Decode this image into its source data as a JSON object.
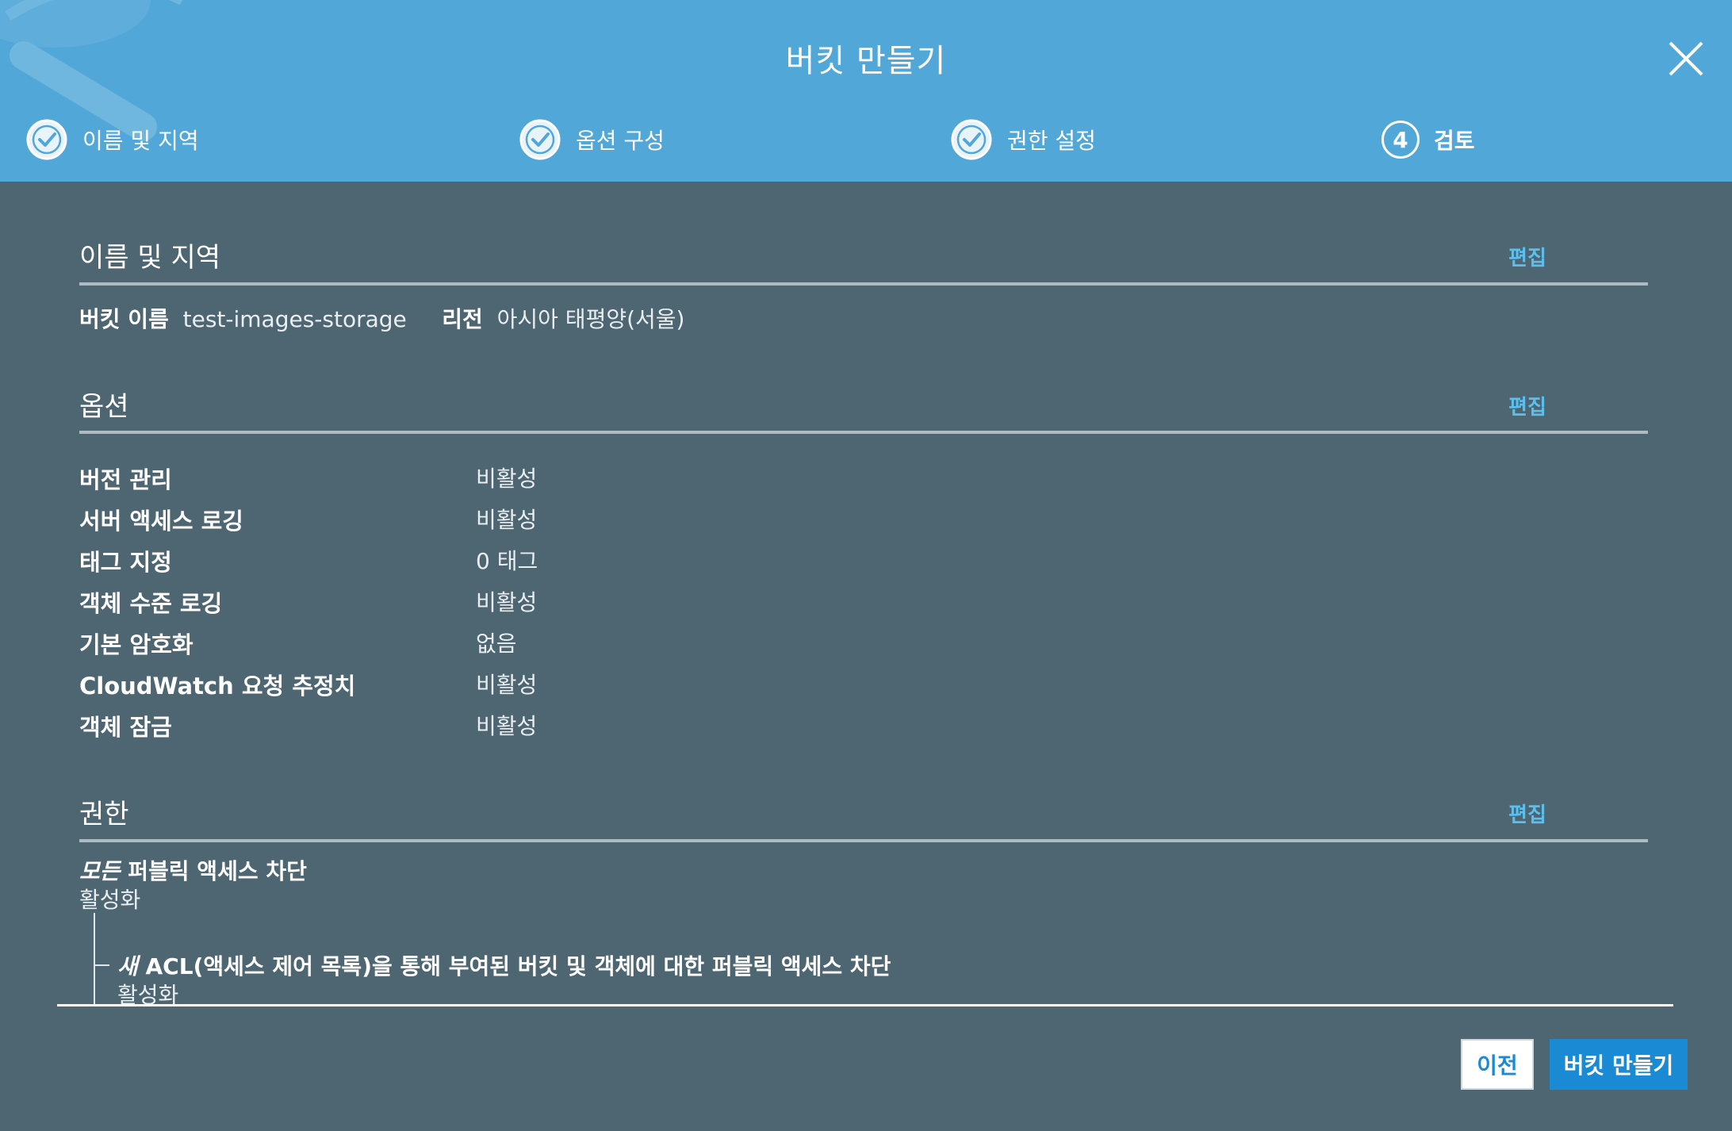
{
  "dialog": {
    "title": "버킷 만들기",
    "close_icon": "close-icon"
  },
  "steps": [
    {
      "label": "이름 및 지역",
      "icon": "check-circle-icon",
      "state": "done"
    },
    {
      "label": "옵션 구성",
      "icon": "check-circle-icon",
      "state": "done"
    },
    {
      "label": "권한 설정",
      "icon": "check-circle-icon",
      "state": "done"
    },
    {
      "label": "검토",
      "number": "4",
      "state": "current"
    }
  ],
  "name_region": {
    "title": "이름 및 지역",
    "edit": "편집",
    "bucket_name_label": "버킷 이름",
    "bucket_name": "test-images-storage",
    "region_label": "리전",
    "region": "아시아 태평양(서울)"
  },
  "options": {
    "title": "옵션",
    "edit": "편집",
    "rows": [
      {
        "label": "버전 관리",
        "value": "비활성"
      },
      {
        "label": "서버 액세스 로깅",
        "value": "비활성"
      },
      {
        "label": "태그 지정",
        "value": "0 태그"
      },
      {
        "label": "객체 수준 로깅",
        "value": "비활성"
      },
      {
        "label": "기본 암호화",
        "value": "없음"
      },
      {
        "label": "CloudWatch 요청 추정치",
        "value": "비활성"
      },
      {
        "label": "객체 잠금",
        "value": "비활성"
      }
    ]
  },
  "permissions": {
    "title": "권한",
    "edit": "편집",
    "block_all": {
      "em": "모든",
      "rest": " 퍼블릭 액세스 차단",
      "value": "활성화"
    },
    "block_new_acl": {
      "em": "새",
      "rest": " ACL(액세스 제어 목록)을 통해 부여된 버킷 및 객체에 대한 퍼블릭 액세스 차단",
      "value": "활성화"
    }
  },
  "footer": {
    "prev": "이전",
    "create": "버킷 만들기"
  },
  "colors": {
    "header_bg": "#51a7d8",
    "body_bg": "#4e6572",
    "link": "#5bc0ee",
    "primary": "#1a8ad4"
  }
}
